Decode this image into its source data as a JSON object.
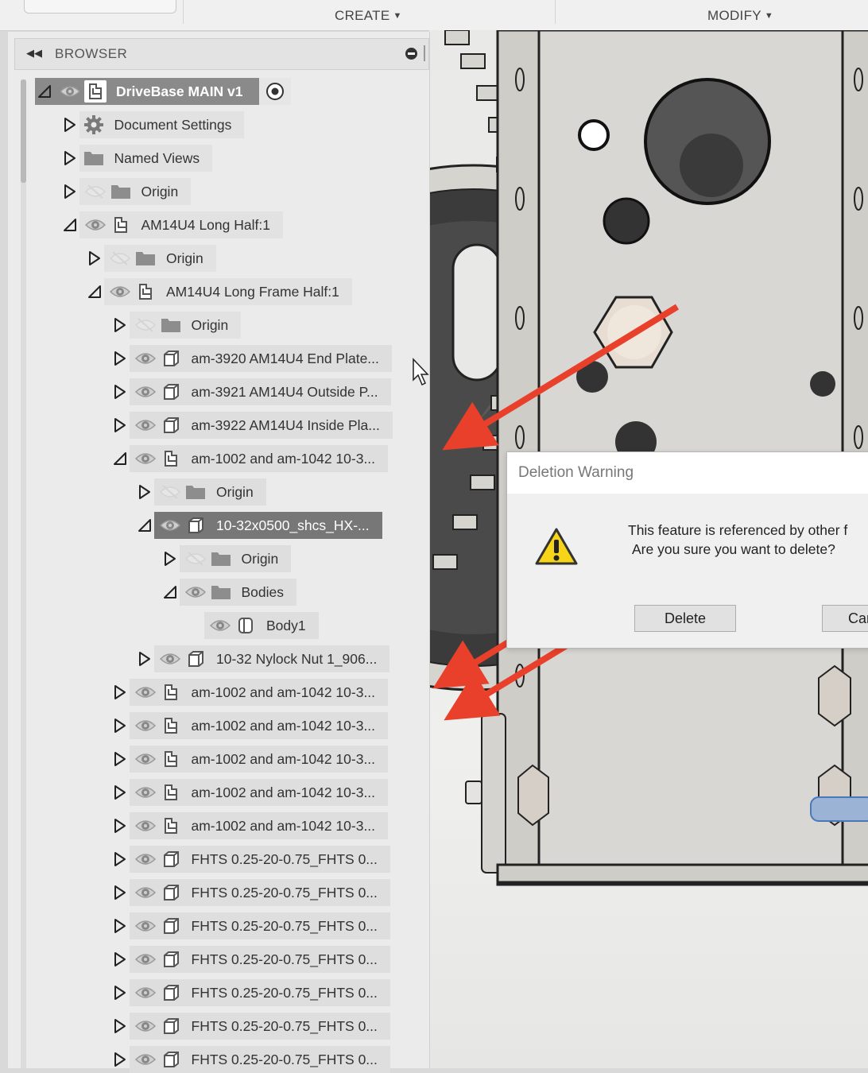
{
  "toolbar": {
    "create_label": "CREATE",
    "modify_label": "MODIFY"
  },
  "browser": {
    "title": "BROWSER",
    "items": [
      {
        "label": "DriveBase MAIN v1",
        "icon": "component-icon",
        "expander": "expanded",
        "visible": true
      },
      {
        "label": "Document Settings",
        "icon": "gear-icon",
        "expander": "collapsed",
        "visible": null
      },
      {
        "label": "Named Views",
        "icon": "folder-icon",
        "expander": "collapsed",
        "visible": null
      },
      {
        "label": "Origin",
        "icon": "folder-icon",
        "expander": "collapsed",
        "visible": false
      },
      {
        "label": "AM14U4 Long Half:1",
        "icon": "component-icon",
        "expander": "expanded",
        "visible": true
      },
      {
        "label": "Origin",
        "icon": "folder-icon",
        "expander": "collapsed",
        "visible": false
      },
      {
        "label": "AM14U4 Long Frame Half:1",
        "icon": "component-icon",
        "expander": "expanded",
        "visible": true
      },
      {
        "label": "Origin",
        "icon": "folder-icon",
        "expander": "collapsed",
        "visible": false
      },
      {
        "label": "am-3920 AM14U4 End Plate...",
        "icon": "body-icon",
        "expander": "collapsed",
        "visible": true
      },
      {
        "label": "am-3921 AM14U4 Outside P...",
        "icon": "body-icon",
        "expander": "collapsed",
        "visible": true
      },
      {
        "label": "am-3922 AM14U4 Inside Pla...",
        "icon": "body-icon",
        "expander": "collapsed",
        "visible": true
      },
      {
        "label": "am-1002 and am-1042 10-3...",
        "icon": "component-icon",
        "expander": "expanded",
        "visible": true
      },
      {
        "label": "Origin",
        "icon": "folder-icon",
        "expander": "collapsed",
        "visible": false
      },
      {
        "label": "10-32x0500_shcs_HX-...",
        "icon": "body-icon",
        "expander": "expanded",
        "visible": true
      },
      {
        "label": "Origin",
        "icon": "folder-icon",
        "expander": "collapsed",
        "visible": false
      },
      {
        "label": "Bodies",
        "icon": "folder-icon",
        "expander": "expanded",
        "visible": true
      },
      {
        "label": "Body1",
        "icon": "solid-body-icon",
        "expander": "none",
        "visible": true
      },
      {
        "label": "10-32 Nylock Nut 1_906...",
        "icon": "body-icon",
        "expander": "collapsed",
        "visible": true
      },
      {
        "label": "am-1002 and am-1042 10-3...",
        "icon": "component-icon",
        "expander": "collapsed",
        "visible": true
      },
      {
        "label": "am-1002 and am-1042 10-3...",
        "icon": "component-icon",
        "expander": "collapsed",
        "visible": true
      },
      {
        "label": "am-1002 and am-1042 10-3...",
        "icon": "component-icon",
        "expander": "collapsed",
        "visible": true
      },
      {
        "label": "am-1002 and am-1042 10-3...",
        "icon": "component-icon",
        "expander": "collapsed",
        "visible": true
      },
      {
        "label": "am-1002 and am-1042 10-3...",
        "icon": "component-icon",
        "expander": "collapsed",
        "visible": true
      },
      {
        "label": "FHTS 0.25-20-0.75_FHTS 0...",
        "icon": "body-icon",
        "expander": "collapsed",
        "visible": true
      },
      {
        "label": "FHTS 0.25-20-0.75_FHTS 0...",
        "icon": "body-icon",
        "expander": "collapsed",
        "visible": true
      },
      {
        "label": "FHTS 0.25-20-0.75_FHTS 0...",
        "icon": "body-icon",
        "expander": "collapsed",
        "visible": true
      },
      {
        "label": "FHTS 0.25-20-0.75_FHTS 0...",
        "icon": "body-icon",
        "expander": "collapsed",
        "visible": true
      },
      {
        "label": "FHTS 0.25-20-0.75_FHTS 0...",
        "icon": "body-icon",
        "expander": "collapsed",
        "visible": true
      },
      {
        "label": "FHTS 0.25-20-0.75_FHTS 0...",
        "icon": "body-icon",
        "expander": "collapsed",
        "visible": true
      },
      {
        "label": "FHTS 0.25-20-0.75_FHTS 0...",
        "icon": "body-icon",
        "expander": "collapsed",
        "visible": true
      }
    ]
  },
  "dialog": {
    "title": "Deletion Warning",
    "message_line1": "This feature is referenced by other f",
    "message_line2": "Are you sure you want to delete?",
    "delete_label": "Delete",
    "cancel_label": "Can",
    "icon": "warning-icon"
  },
  "colors": {
    "annotation_arrow": "#e8402a",
    "root_row": "#8a8a8a",
    "selected_row": "#777777",
    "panel_bg": "#ebebeb"
  }
}
